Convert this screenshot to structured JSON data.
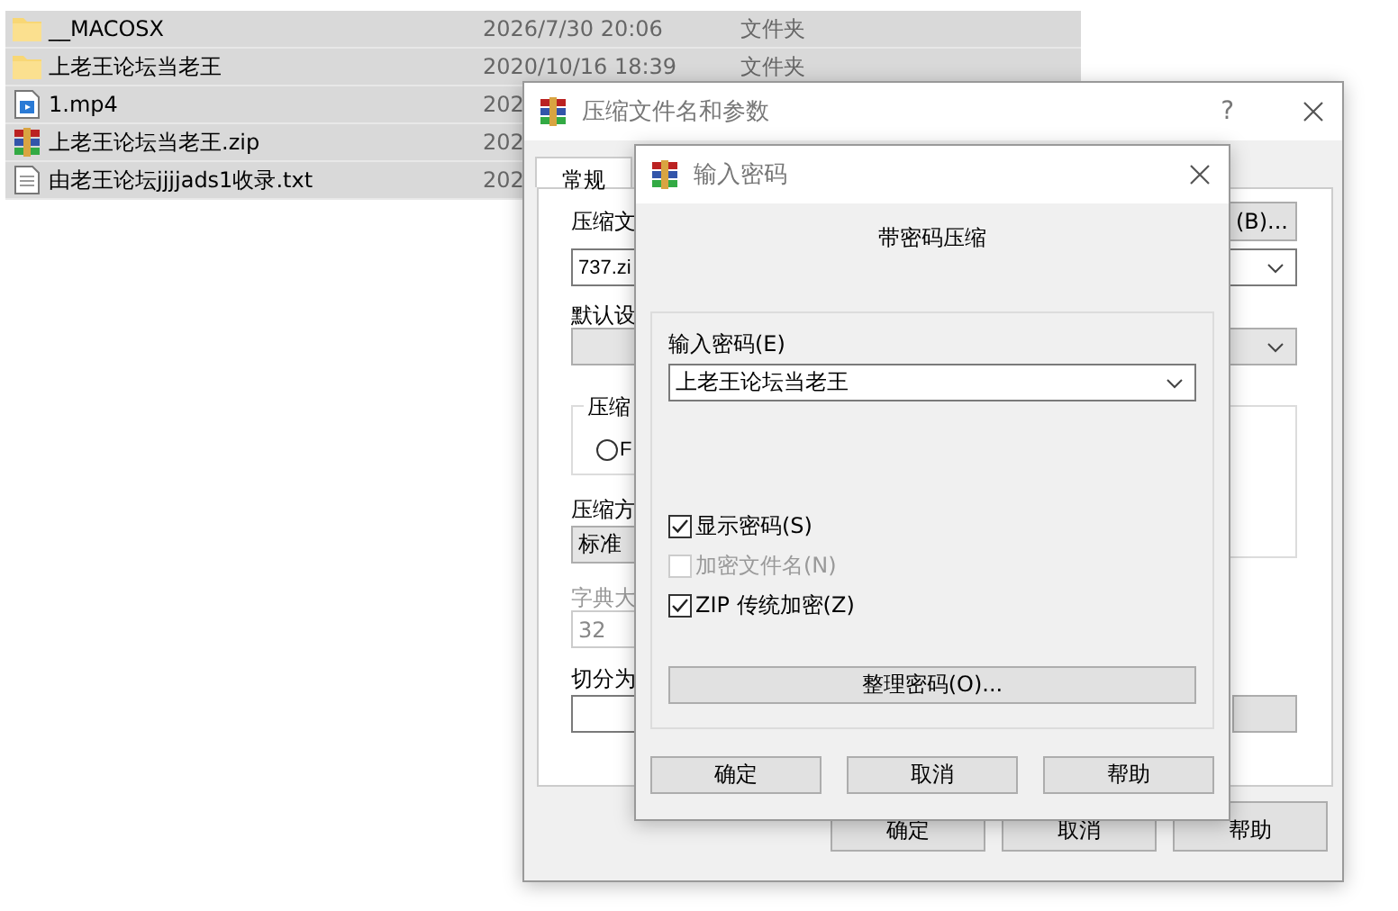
{
  "file_list": {
    "rows": [
      {
        "kind": "folder",
        "name": "__MACOSX",
        "date": "2026/7/30 20:06",
        "type": "文件夹",
        "selected": true
      },
      {
        "kind": "folder",
        "name": "上老王论坛当老王",
        "date": "2020/10/16 18:39",
        "type": "文件夹",
        "selected": true
      },
      {
        "kind": "video",
        "name": "1.mp4",
        "date": "202",
        "selected": true
      },
      {
        "kind": "archive",
        "name": "上老王论坛当老王.zip",
        "date": "202",
        "selected": true
      },
      {
        "kind": "text",
        "name": "由老王论坛jjjjads1收录.txt",
        "date": "202",
        "selected": true
      }
    ]
  },
  "archive_dialog": {
    "title": "压缩文件名和参数",
    "help": "?",
    "tabs": [
      {
        "label": "常规",
        "selected": true
      }
    ],
    "archive_name_label": "压缩文",
    "browse_button": "(B)...",
    "archive_name": "737.zi",
    "profile_label": "默认设",
    "format_group": "压缩",
    "format_radio": {
      "label": "F",
      "selected": false
    },
    "method_label": "压缩方",
    "method": "标准",
    "dictionary": {
      "label": "字典大",
      "value": "32",
      "disabled": true
    },
    "split_label": "切分为",
    "buttons": [
      "确定",
      "取消",
      "帮助"
    ]
  },
  "password_dialog": {
    "title": "输入密码",
    "heading": "带密码压缩",
    "password_label": "输入密码(E)",
    "password": "上老王论坛当老王",
    "options": [
      {
        "label": "显示密码(S)",
        "checked": true,
        "disabled": false
      },
      {
        "label": "加密文件名(N)",
        "checked": false,
        "disabled": true
      },
      {
        "label": "ZIP 传统加密(Z)",
        "checked": true,
        "disabled": false
      }
    ],
    "organize_button": "整理密码(O)...",
    "buttons": [
      "确定",
      "取消",
      "帮助"
    ]
  }
}
